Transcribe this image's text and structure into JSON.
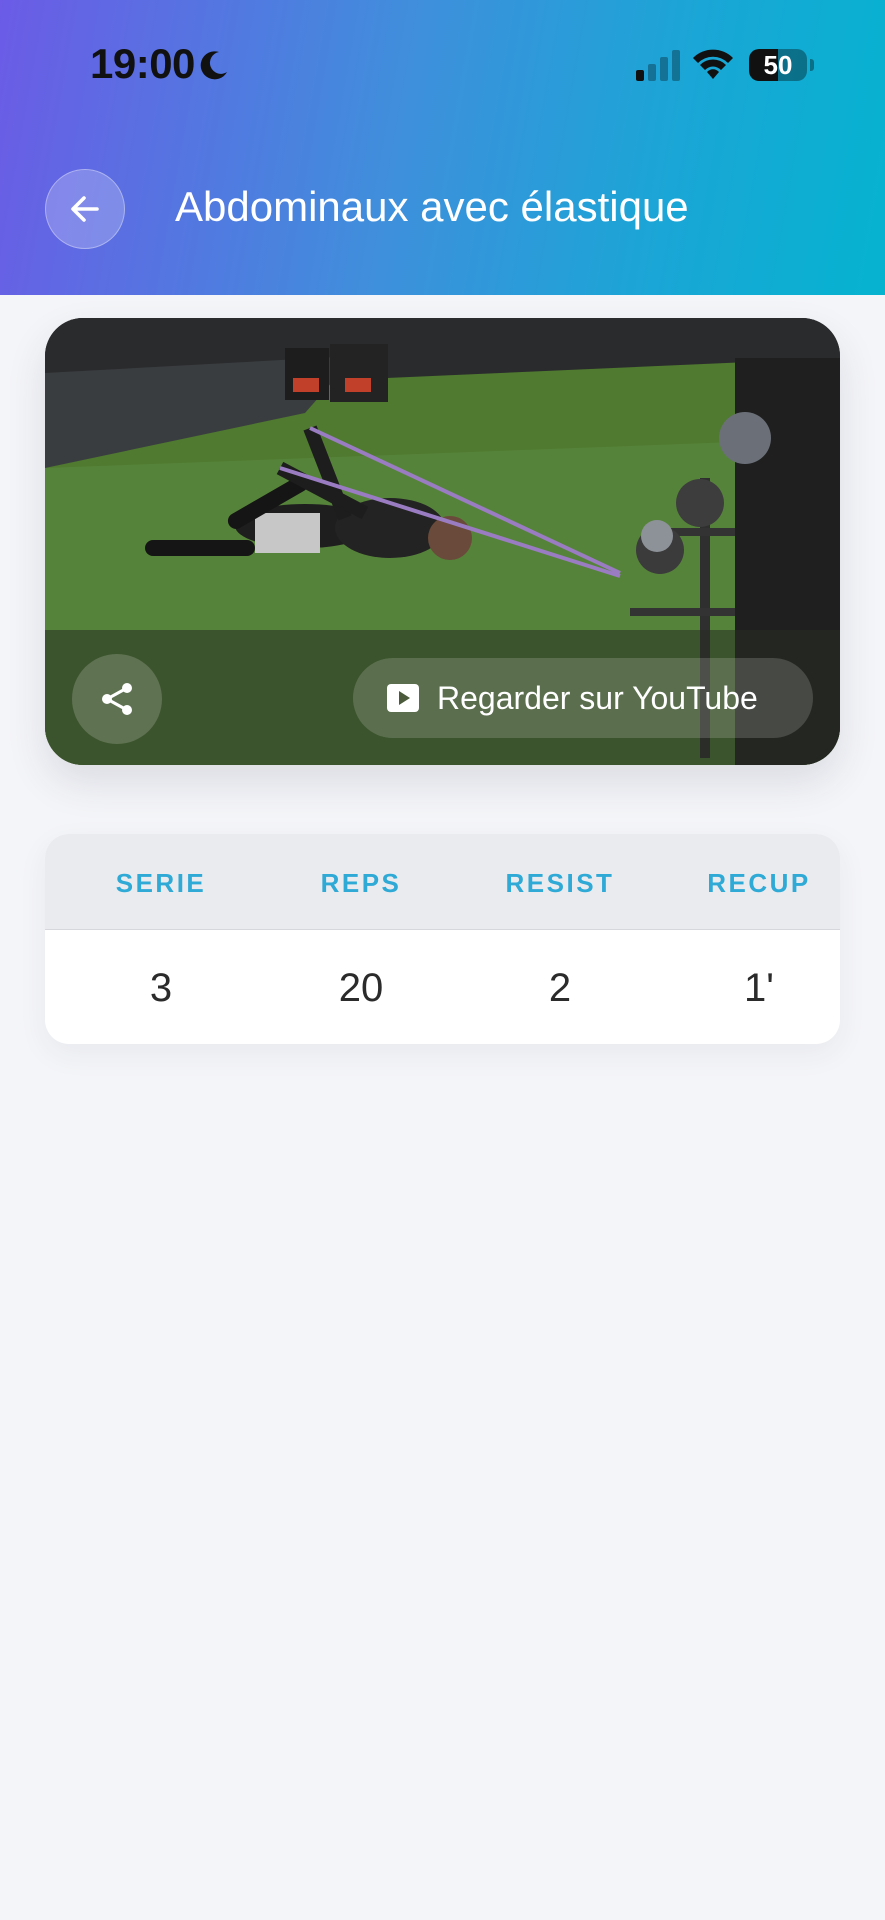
{
  "status_bar": {
    "time": "19:00",
    "battery": "50"
  },
  "header": {
    "title": "Abdominaux avec élastique"
  },
  "video": {
    "youtube_label": "Regarder sur YouTube"
  },
  "stats": {
    "headers": [
      "SERIE",
      "REPS",
      "RESIST",
      "RECUP"
    ],
    "values": [
      "3",
      "20",
      "2",
      "1'"
    ]
  },
  "colors": {
    "header_gradient_start": "#6b5be6",
    "header_gradient_end": "#05b3cf",
    "table_header_text": "#2fa9d6",
    "page_background": "#f4f5f8"
  },
  "icons": {
    "back": "arrow-left-icon",
    "share": "share-icon",
    "youtube": "youtube-play-icon",
    "moon": "moon-icon",
    "signal": "cellular-signal-icon",
    "wifi": "wifi-icon"
  }
}
